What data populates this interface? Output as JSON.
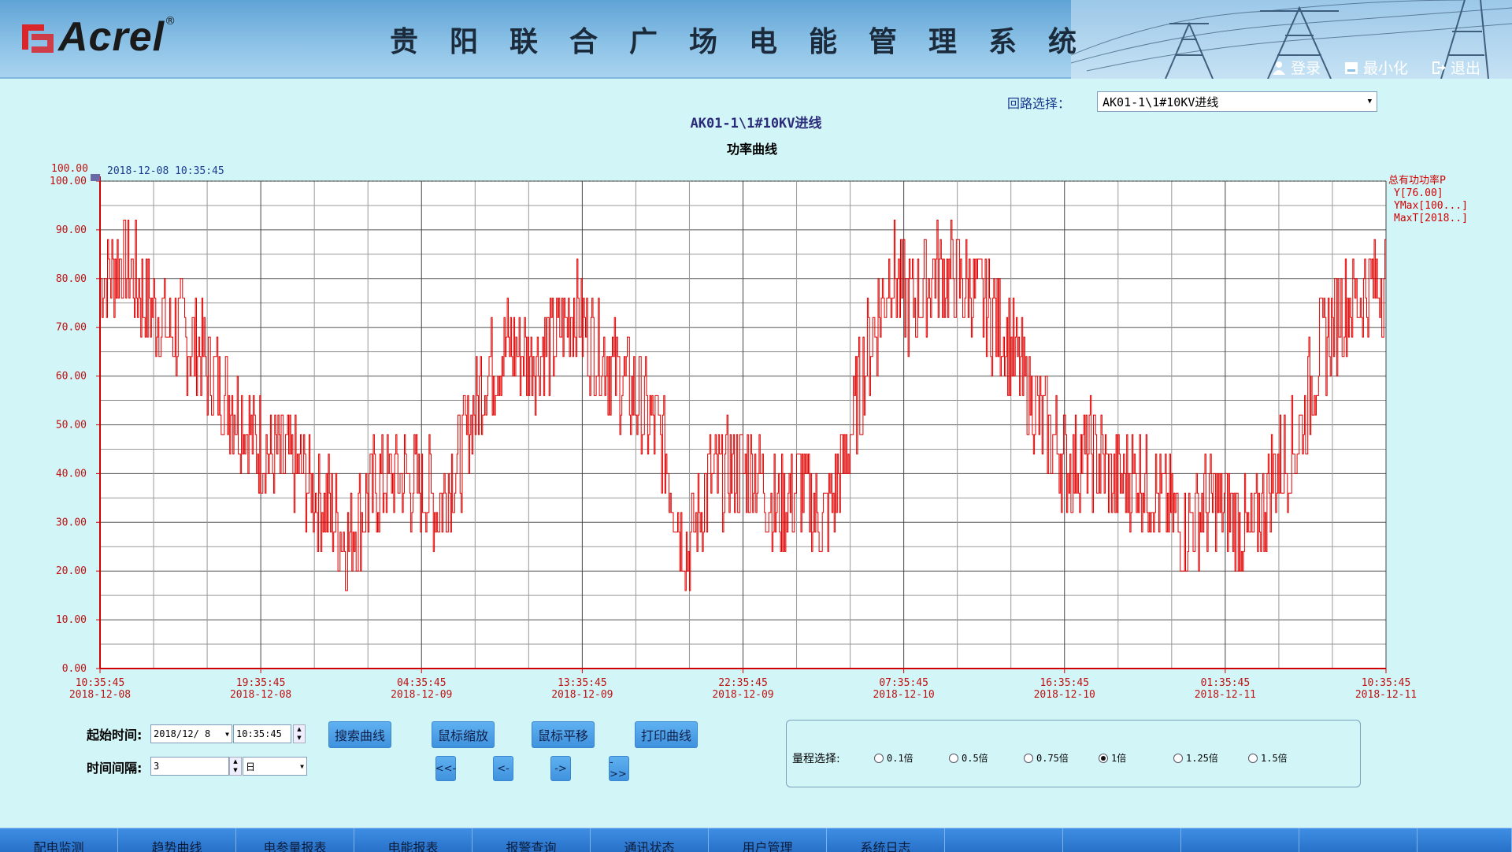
{
  "header": {
    "logo_text": "Acrel",
    "title": "贵阳联合广场电能管理系统",
    "actions": [
      {
        "label": "登录",
        "icon": "user-icon"
      },
      {
        "label": "最小化",
        "icon": "minimize-icon"
      },
      {
        "label": "退出",
        "icon": "logout-icon"
      }
    ]
  },
  "loop_select": {
    "label": "回路选择：",
    "value": "AK01-1\\1#10KV进线"
  },
  "loop_name": "AK01-1\\1#10KV进线",
  "chart_title": "功率曲线",
  "chart_data": {
    "type": "line",
    "title": "功率曲线",
    "cursor_time": "2018-12-08 10:35:45",
    "ylim": [
      0,
      100
    ],
    "y_ticks": [
      "0.00",
      "10.00",
      "20.00",
      "30.00",
      "40.00",
      "50.00",
      "60.00",
      "70.00",
      "80.00",
      "90.00",
      "100.00"
    ],
    "y_top_label": "100.00",
    "x_ticks": [
      {
        "time": "10:35:45",
        "date": "2018-12-08"
      },
      {
        "time": "19:35:45",
        "date": "2018-12-08"
      },
      {
        "time": "04:35:45",
        "date": "2018-12-09"
      },
      {
        "time": "13:35:45",
        "date": "2018-12-09"
      },
      {
        "time": "22:35:45",
        "date": "2018-12-09"
      },
      {
        "time": "07:35:45",
        "date": "2018-12-10"
      },
      {
        "time": "16:35:45",
        "date": "2018-12-10"
      },
      {
        "time": "01:35:45",
        "date": "2018-12-11"
      },
      {
        "time": "10:35:45",
        "date": "2018-12-11"
      }
    ],
    "grid": true,
    "series_color": "#e00000",
    "legend": {
      "name": "总有功功率P",
      "lines": [
        "Y[76.00]",
        "YMax[100...]",
        "MaxT[2018..]"
      ],
      "placement": "right"
    },
    "trend": [
      [
        0,
        80
      ],
      [
        3,
        84
      ],
      [
        6,
        76
      ],
      [
        9,
        70
      ],
      [
        12,
        68
      ],
      [
        15,
        60
      ],
      [
        18,
        54
      ],
      [
        21,
        46
      ],
      [
        24,
        42
      ],
      [
        27,
        40
      ],
      [
        30,
        34
      ],
      [
        33,
        26
      ],
      [
        36,
        36
      ],
      [
        39,
        40
      ],
      [
        42,
        38
      ],
      [
        45,
        34
      ],
      [
        48,
        44
      ],
      [
        51,
        60
      ],
      [
        54,
        66
      ],
      [
        57,
        64
      ],
      [
        60,
        66
      ],
      [
        63,
        74
      ],
      [
        66,
        66
      ],
      [
        69,
        60
      ],
      [
        72,
        54
      ],
      [
        75,
        46
      ],
      [
        78,
        24
      ],
      [
        81,
        38
      ],
      [
        84,
        40
      ],
      [
        87,
        42
      ],
      [
        90,
        32
      ],
      [
        93,
        38
      ],
      [
        96,
        30
      ],
      [
        99,
        42
      ],
      [
        102,
        64
      ],
      [
        105,
        82
      ],
      [
        108,
        74
      ],
      [
        111,
        82
      ],
      [
        114,
        80
      ],
      [
        117,
        76
      ],
      [
        120,
        70
      ],
      [
        123,
        58
      ],
      [
        126,
        48
      ],
      [
        129,
        42
      ],
      [
        132,
        44
      ],
      [
        135,
        38
      ],
      [
        138,
        40
      ],
      [
        141,
        36
      ],
      [
        144,
        28
      ],
      [
        147,
        34
      ],
      [
        150,
        32
      ],
      [
        153,
        26
      ],
      [
        156,
        40
      ],
      [
        159,
        46
      ],
      [
        162,
        64
      ],
      [
        165,
        74
      ],
      [
        168,
        78
      ],
      [
        171,
        80
      ]
    ]
  },
  "controls": {
    "start_label": "起始时间:",
    "start_date": "2018/12/ 8",
    "start_time": "10:35:45",
    "interval_label": "时间间隔:",
    "interval_value": "3",
    "interval_unit": "日",
    "buttons": [
      "搜索曲线",
      "鼠标缩放",
      "鼠标平移",
      "打印曲线"
    ],
    "nav_buttons": [
      "<<-",
      "<-",
      "->",
      "->>"
    ],
    "range_label": "量程选择:",
    "range_options": [
      {
        "label": "0.1倍",
        "selected": false
      },
      {
        "label": "0.5倍",
        "selected": false
      },
      {
        "label": "0.75倍",
        "selected": false
      },
      {
        "label": "1倍",
        "selected": true
      },
      {
        "label": "1.25倍",
        "selected": false
      },
      {
        "label": "1.5倍",
        "selected": false
      }
    ]
  },
  "footer_tabs": [
    "配电监测",
    "趋势曲线",
    "电参量报表",
    "电能报表",
    "报警查询",
    "通讯状态",
    "用户管理",
    "系统日志"
  ]
}
